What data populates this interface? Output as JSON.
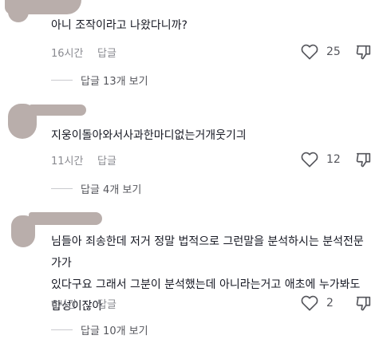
{
  "comments": [
    {
      "text": "아니 조작이라고 나왔다니까?",
      "time": "16시간",
      "reply_label": "답글",
      "likes": "25",
      "view_replies": "답글 13개 보기"
    },
    {
      "text": "지웅이돌아와서사과한마디없는거개웃기긔",
      "time": "11시간",
      "reply_label": "답글",
      "likes": "12",
      "view_replies": "답글 4개 보기"
    },
    {
      "text": "님들아 죄송한데 저거 정말 법적으로 그런말을 분석하시는 분석전문가가\n있다구요 그래서 그분이 분석했는데 아니라는거고 애초에 누가봐도\n합성이잖아",
      "time": "6시간",
      "reply_label": "답글",
      "likes": "2",
      "view_replies": "답글 10개 보기"
    }
  ],
  "icons": {
    "like": "heart-outline-icon",
    "dislike": "thumbs-down-outline-icon"
  },
  "colors": {
    "redaction": "#b9aeab",
    "text": "#161823",
    "meta": "#8a8b91"
  }
}
